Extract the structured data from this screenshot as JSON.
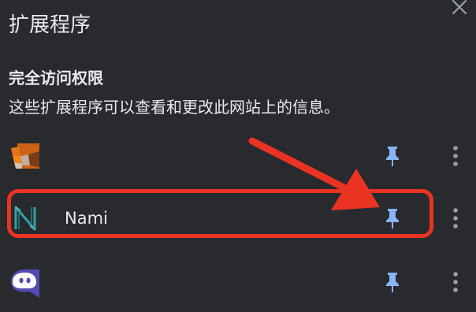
{
  "header": {
    "title": "扩展程序"
  },
  "section": {
    "title": "完全访问权限",
    "description": "这些扩展程序可以查看和更改此网站上的信息。"
  },
  "extensions": [
    {
      "name": "",
      "icon": "metamask-fox-icon",
      "pinned": true
    },
    {
      "name": "Nami",
      "icon": "nami-logo-icon",
      "pinned": true
    },
    {
      "name": "",
      "icon": "phantom-ghost-icon",
      "pinned": true
    }
  ],
  "colors": {
    "background": "#292a2d",
    "text": "#e8eaed",
    "pin": "#8ab4f8",
    "more": "#9aa0a6",
    "annotation": "#ea3323"
  }
}
